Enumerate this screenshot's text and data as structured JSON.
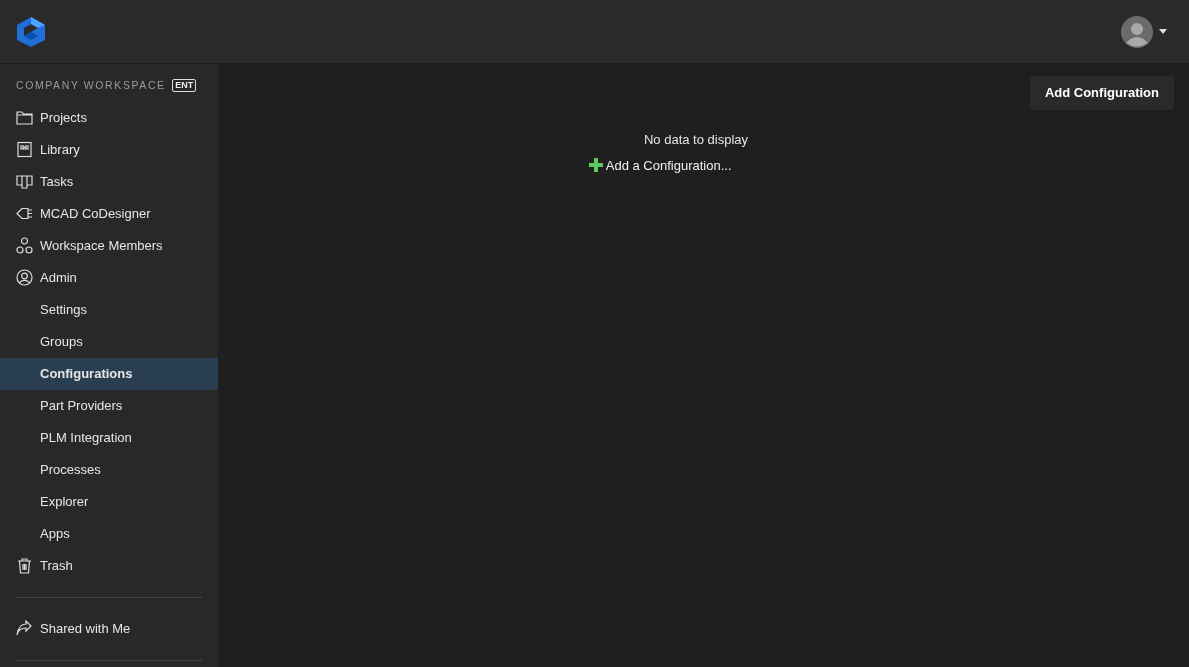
{
  "sidebar": {
    "workspace_label": "COMPANY WORKSPACE",
    "workspace_badge": "ENT",
    "items": [
      {
        "label": "Projects",
        "kind": "main",
        "selected": false
      },
      {
        "label": "Library",
        "kind": "main",
        "selected": false
      },
      {
        "label": "Tasks",
        "kind": "main",
        "selected": false
      },
      {
        "label": "MCAD CoDesigner",
        "kind": "main",
        "selected": false
      },
      {
        "label": "Workspace Members",
        "kind": "main",
        "selected": false
      },
      {
        "label": "Admin",
        "kind": "main",
        "selected": false
      },
      {
        "label": "Settings",
        "kind": "sub",
        "selected": false
      },
      {
        "label": "Groups",
        "kind": "sub",
        "selected": false
      },
      {
        "label": "Configurations",
        "kind": "sub",
        "selected": true
      },
      {
        "label": "Part Providers",
        "kind": "sub",
        "selected": false
      },
      {
        "label": "PLM Integration",
        "kind": "sub",
        "selected": false
      },
      {
        "label": "Processes",
        "kind": "sub",
        "selected": false
      },
      {
        "label": "Explorer",
        "kind": "sub",
        "selected": false
      },
      {
        "label": "Apps",
        "kind": "sub",
        "selected": false
      },
      {
        "label": "Trash",
        "kind": "main",
        "selected": false
      }
    ],
    "shared": {
      "label": "Shared with Me"
    }
  },
  "main": {
    "add_button": "Add Configuration",
    "empty_message": "No data to display",
    "add_link": "Add a Configuration..."
  }
}
